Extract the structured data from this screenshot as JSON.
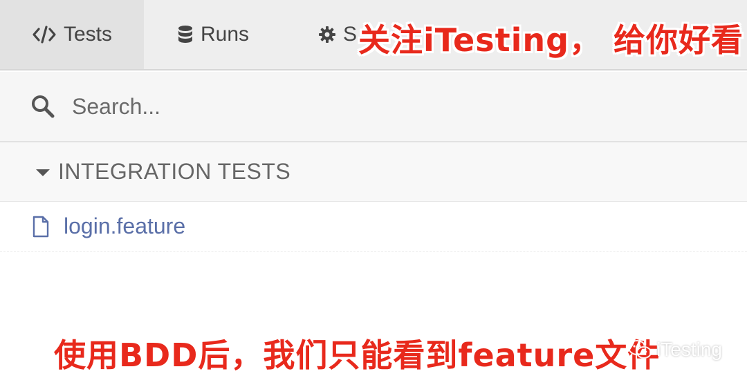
{
  "nav": {
    "tabs": [
      {
        "label": "Tests",
        "icon": "code-icon",
        "active": true
      },
      {
        "label": "Runs",
        "icon": "database-icon",
        "active": false
      },
      {
        "label": "S",
        "icon": "gear-icon",
        "active": false
      }
    ]
  },
  "search": {
    "placeholder": "Search..."
  },
  "section": {
    "title": "INTEGRATION TESTS",
    "icon": "caret-down-icon"
  },
  "files": [
    {
      "name": "login.feature",
      "icon": "file-icon"
    }
  ],
  "overlay": {
    "top_caption": "关注iTesting， 给你好看",
    "bottom_caption": "使用BDD后，我们只能看到feature文件",
    "caption_color": "#e8291c"
  },
  "watermark": {
    "text": "iTesting",
    "icon": "wechat-icon"
  },
  "colors": {
    "nav_bg": "#eeeeee",
    "active_tab_bg": "#e2e2e2",
    "search_bg": "#f6f6f6",
    "link": "#5a6fa8"
  }
}
